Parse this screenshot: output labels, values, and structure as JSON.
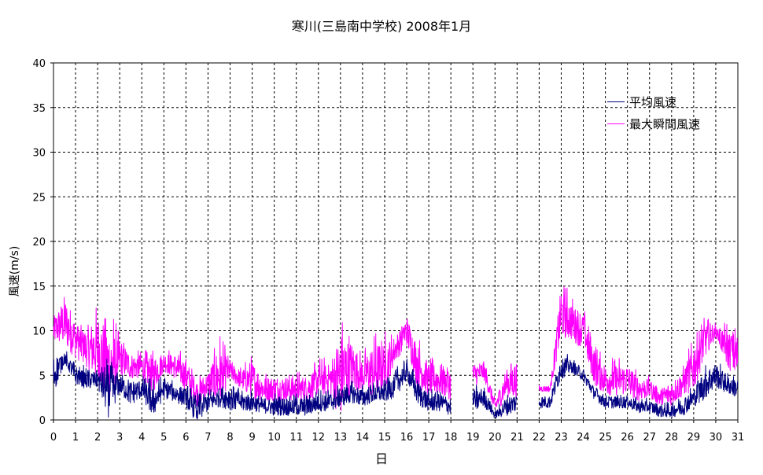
{
  "chart_data": {
    "type": "line",
    "title": "寒川(三島南中学校)  2008年1月",
    "xlabel": "日",
    "ylabel": "風速(m/s)",
    "xlim": [
      0,
      31
    ],
    "ylim": [
      0,
      40
    ],
    "x_ticks": [
      0,
      1,
      2,
      3,
      4,
      5,
      6,
      7,
      8,
      9,
      10,
      11,
      12,
      13,
      14,
      15,
      16,
      17,
      18,
      19,
      20,
      21,
      22,
      23,
      24,
      25,
      26,
      27,
      28,
      29,
      30,
      31
    ],
    "y_ticks": [
      0,
      5,
      10,
      15,
      20,
      25,
      30,
      35,
      40
    ],
    "grid": true,
    "legend_position": "top-right",
    "series": [
      {
        "name": "平均風速",
        "color": "#000080",
        "x": [
          0,
          0.5,
          1,
          1.5,
          2,
          2.5,
          3,
          3.5,
          4,
          4.5,
          5,
          5.5,
          6,
          6.5,
          7,
          7.5,
          8,
          8.5,
          9,
          9.5,
          10,
          10.5,
          11,
          11.5,
          12,
          12.5,
          13,
          13.5,
          14,
          14.5,
          15,
          15.5,
          16,
          16.5,
          17,
          17.5,
          18,
          18.5,
          19,
          19.5,
          20,
          20.5,
          21,
          21.5,
          22,
          22.5,
          23,
          23.5,
          24,
          24.5,
          25,
          25.5,
          26,
          26.5,
          27,
          27.5,
          28,
          28.5,
          29,
          29.5,
          30,
          30.5,
          31
        ],
        "values": [
          5,
          7,
          5,
          4.5,
          4.5,
          3,
          4,
          3,
          3.5,
          2,
          3.5,
          3,
          2.5,
          1,
          2,
          2.5,
          2.5,
          2,
          2,
          1.5,
          1.5,
          1.5,
          1.5,
          1.5,
          2,
          2,
          2.5,
          3,
          2.5,
          3,
          3,
          4,
          5.5,
          3,
          2,
          2,
          1.5,
          null,
          2,
          2.5,
          0.5,
          1.5,
          2,
          null,
          2,
          2,
          6,
          6,
          5,
          3,
          2,
          2,
          2,
          1.5,
          1.5,
          1,
          1,
          1.5,
          2.5,
          4,
          5,
          4,
          3.5
        ],
        "values_peak": [
          8,
          8,
          6.5,
          6,
          6,
          7,
          5.5,
          5,
          5,
          4.5,
          5,
          4.5,
          4,
          3,
          3.5,
          4,
          4.5,
          3.5,
          3.5,
          2.5,
          3,
          3,
          3,
          3,
          3.5,
          3.5,
          4,
          4.5,
          4,
          4.5,
          4.5,
          6,
          7,
          5,
          3.5,
          3.5,
          3,
          null,
          4,
          4,
          1,
          3,
          3.5,
          null,
          3,
          3,
          8,
          7,
          6,
          4,
          3,
          3,
          3,
          2.5,
          2.5,
          2,
          2,
          3,
          4,
          6.5,
          7,
          5.5,
          5
        ]
      },
      {
        "name": "最大瞬間風速",
        "color": "#ff00ff",
        "x": [
          0,
          0.5,
          1,
          1.5,
          2,
          2.5,
          3,
          3.5,
          4,
          4.5,
          5,
          5.5,
          6,
          6.5,
          7,
          7.5,
          8,
          8.5,
          9,
          9.5,
          10,
          10.5,
          11,
          11.5,
          12,
          12.5,
          13,
          13.5,
          14,
          14.5,
          15,
          15.5,
          16,
          16.5,
          17,
          17.5,
          18,
          18.5,
          19,
          19.5,
          20,
          20.5,
          21,
          21.5,
          22,
          22.5,
          23,
          23.5,
          24,
          24.5,
          25,
          25.5,
          26,
          26.5,
          27,
          27.5,
          28,
          28.5,
          29,
          29.5,
          30,
          30.5,
          31
        ],
        "values": [
          10,
          11,
          9,
          8,
          8,
          6,
          7,
          6,
          6,
          5,
          6.5,
          6,
          5,
          3,
          4,
          5,
          5.5,
          4.5,
          4.5,
          3.5,
          3.5,
          3.5,
          3.5,
          3.5,
          4.5,
          4.5,
          5,
          6,
          5,
          5.5,
          6,
          8,
          10,
          6,
          4.5,
          4.5,
          4,
          null,
          5,
          5.5,
          1.5,
          4,
          4.5,
          null,
          3.5,
          3.5,
          12,
          11,
          10,
          6,
          4.5,
          4.5,
          4.5,
          3.5,
          3.5,
          2.5,
          3,
          4,
          6,
          9,
          10,
          8,
          7
        ],
        "values_peak": [
          12,
          15,
          12,
          11,
          13.5,
          12.5,
          10,
          8,
          8,
          8,
          8,
          8,
          7.5,
          5,
          6,
          10,
          7,
          6,
          7.5,
          5.5,
          5.5,
          5.5,
          5.5,
          5.5,
          7,
          7,
          12,
          10,
          7.5,
          10,
          10,
          10,
          12.5,
          9.5,
          7,
          7,
          6.5,
          null,
          7,
          7,
          2.5,
          6.5,
          7.5,
          null,
          4,
          4,
          16,
          14,
          13,
          9,
          7,
          7,
          7,
          5.5,
          5,
          4,
          5,
          6,
          10,
          12,
          11,
          11,
          11
        ]
      }
    ]
  }
}
